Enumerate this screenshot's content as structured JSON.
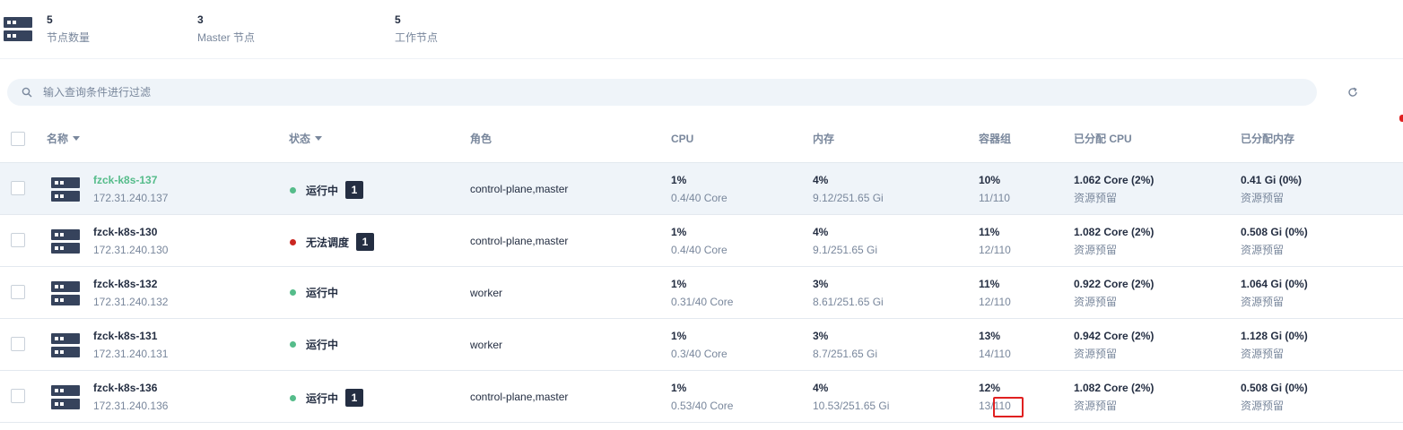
{
  "summary": {
    "stats": [
      {
        "value": "5",
        "label": "节点数量"
      },
      {
        "value": "3",
        "label": "Master 节点"
      },
      {
        "value": "5",
        "label": "工作节点"
      }
    ]
  },
  "search": {
    "placeholder": "输入查询条件进行过滤"
  },
  "table": {
    "headers": {
      "name": "名称",
      "status": "状态",
      "role": "角色",
      "cpu": "CPU",
      "memory": "内存",
      "pods": "容器组",
      "allocated_cpu": "已分配 CPU",
      "allocated_memory": "已分配内存"
    },
    "rows": [
      {
        "name": "fzck-k8s-137",
        "ip": "172.31.240.137",
        "status": "运行中",
        "status_color": "#55bc8a",
        "badge": "1",
        "role": "control-plane,master",
        "cpu_pct": "1%",
        "cpu_detail": "0.4/40 Core",
        "mem_pct": "4%",
        "mem_detail": "9.12/251.65 Gi",
        "pods_pct": "10%",
        "pods_detail": "11/110",
        "acpu": "1.062 Core (2%)",
        "acpu_sub": "资源预留",
        "amem": "0.41 Gi (0%)",
        "amem_sub": "资源预留"
      },
      {
        "name": "fzck-k8s-130",
        "ip": "172.31.240.130",
        "status": "无法调度",
        "status_color": "#ca2621",
        "badge": "1",
        "role": "control-plane,master",
        "cpu_pct": "1%",
        "cpu_detail": "0.4/40 Core",
        "mem_pct": "4%",
        "mem_detail": "9.1/251.65 Gi",
        "pods_pct": "11%",
        "pods_detail": "12/110",
        "acpu": "1.082 Core (2%)",
        "acpu_sub": "资源预留",
        "amem": "0.508 Gi (0%)",
        "amem_sub": "资源预留"
      },
      {
        "name": "fzck-k8s-132",
        "ip": "172.31.240.132",
        "status": "运行中",
        "status_color": "#55bc8a",
        "badge": "",
        "role": "worker",
        "cpu_pct": "1%",
        "cpu_detail": "0.31/40 Core",
        "mem_pct": "3%",
        "mem_detail": "8.61/251.65 Gi",
        "pods_pct": "11%",
        "pods_detail": "12/110",
        "acpu": "0.922 Core (2%)",
        "acpu_sub": "资源预留",
        "amem": "1.064 Gi (0%)",
        "amem_sub": "资源预留"
      },
      {
        "name": "fzck-k8s-131",
        "ip": "172.31.240.131",
        "status": "运行中",
        "status_color": "#55bc8a",
        "badge": "",
        "role": "worker",
        "cpu_pct": "1%",
        "cpu_detail": "0.3/40 Core",
        "mem_pct": "3%",
        "mem_detail": "8.7/251.65 Gi",
        "pods_pct": "13%",
        "pods_detail": "14/110",
        "acpu": "0.942 Core (2%)",
        "acpu_sub": "资源预留",
        "amem": "1.128 Gi (0%)",
        "amem_sub": "资源预留"
      },
      {
        "name": "fzck-k8s-136",
        "ip": "172.31.240.136",
        "status": "运行中",
        "status_color": "#55bc8a",
        "badge": "1",
        "role": "control-plane,master",
        "cpu_pct": "1%",
        "cpu_detail": "0.53/40 Core",
        "mem_pct": "4%",
        "mem_detail": "10.53/251.65 Gi",
        "pods_pct": "12%",
        "pods_detail": "13/110",
        "acpu": "1.082 Core (2%)",
        "acpu_sub": "资源预留",
        "amem": "0.508 Gi (0%)",
        "amem_sub": "资源预留"
      }
    ]
  }
}
